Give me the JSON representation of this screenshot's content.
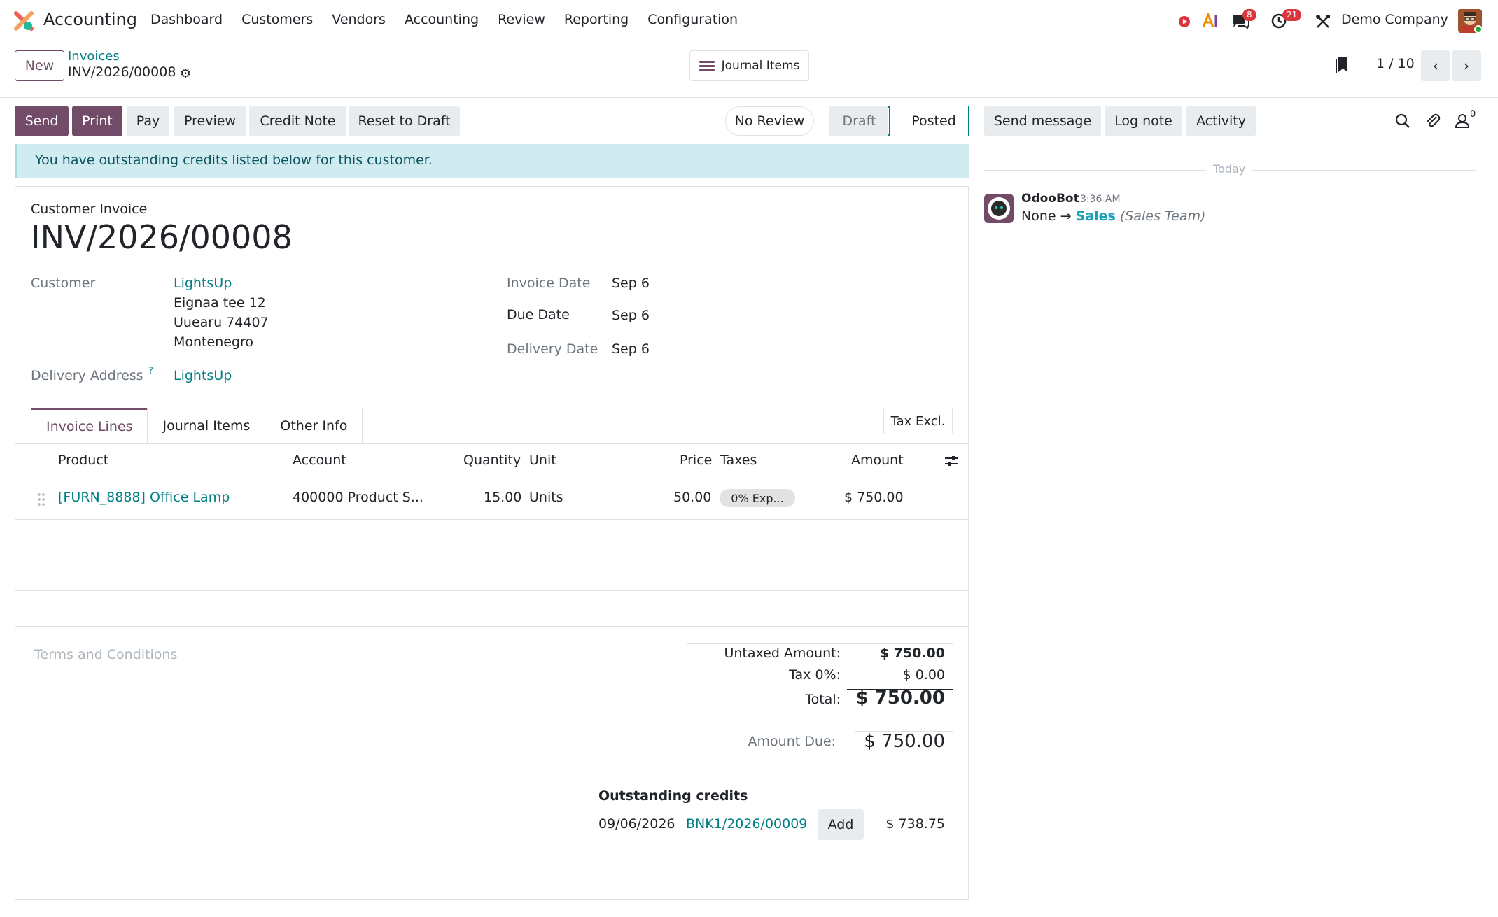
{
  "navbar": {
    "app_name": "Accounting",
    "menu": [
      "Dashboard",
      "Customers",
      "Vendors",
      "Accounting",
      "Review",
      "Reporting",
      "Configuration"
    ],
    "messages_badge": "8",
    "activities_badge": "21",
    "company": "Demo Company"
  },
  "control_panel": {
    "new_label": "New",
    "breadcrumb_parent": "Invoices",
    "breadcrumb_current": "INV/2026/00008",
    "journal_items_label": "Journal Items",
    "pager": "1 / 10"
  },
  "actions": {
    "send": "Send",
    "print": "Print",
    "pay": "Pay",
    "preview": "Preview",
    "credit_note": "Credit Note",
    "reset_to_draft": "Reset to Draft",
    "no_review": "No Review",
    "status_draft": "Draft",
    "status_posted": "Posted"
  },
  "alert": "You have outstanding credits listed below for this customer.",
  "form": {
    "doc_type": "Customer Invoice",
    "number": "INV/2026/00008",
    "customer_label": "Customer",
    "customer_name": "LightsUp",
    "address_line1": "Eignaa tee 12",
    "address_line2": "Uuearu 74407",
    "address_line3": "Montenegro",
    "delivery_address_label": "Delivery Address",
    "delivery_help": "?",
    "delivery_address": "LightsUp",
    "invoice_date_label": "Invoice Date",
    "invoice_date": "Sep 6",
    "due_date_label": "Due Date",
    "due_date": "Sep 6",
    "delivery_date_label": "Delivery Date",
    "delivery_date": "Sep 6"
  },
  "tabs": [
    "Invoice Lines",
    "Journal Items",
    "Other Info"
  ],
  "tax_excl": "Tax Excl.",
  "lines": {
    "headers": {
      "product": "Product",
      "account": "Account",
      "quantity": "Quantity",
      "unit": "Unit",
      "price": "Price",
      "taxes": "Taxes",
      "amount": "Amount"
    },
    "rows": [
      {
        "product": "[FURN_8888] Office Lamp",
        "account": "400000 Product S...",
        "quantity": "15.00",
        "unit": "Units",
        "price": "50.00",
        "taxes": "0% Exp...",
        "amount": "$ 750.00"
      }
    ]
  },
  "terms_placeholder": "Terms and Conditions",
  "totals": {
    "untaxed_label": "Untaxed Amount:",
    "untaxed_value": "$ 750.00",
    "tax_label": "Tax 0%:",
    "tax_value": "$ 0.00",
    "total_label": "Total:",
    "total_value": "$ 750.00",
    "amount_due_label": "Amount Due:",
    "amount_due_value": "$ 750.00"
  },
  "outstanding": {
    "title": "Outstanding credits",
    "date": "09/06/2026",
    "ref": "BNK1/2026/00009",
    "add_label": "Add",
    "amount": "$ 738.75"
  },
  "chatter": {
    "send_message": "Send message",
    "log_note": "Log note",
    "activity": "Activity",
    "followers_count": "0",
    "today": "Today",
    "author": "OdooBot",
    "time": "3:36 AM",
    "change_from": "None",
    "arrow": "→",
    "change_to": "Sales",
    "field": "(Sales Team)"
  },
  "colors": {
    "brand": "#714b67",
    "link": "#017e84",
    "alert_bg": "#d1ecf1",
    "badge": "#d9363e"
  }
}
